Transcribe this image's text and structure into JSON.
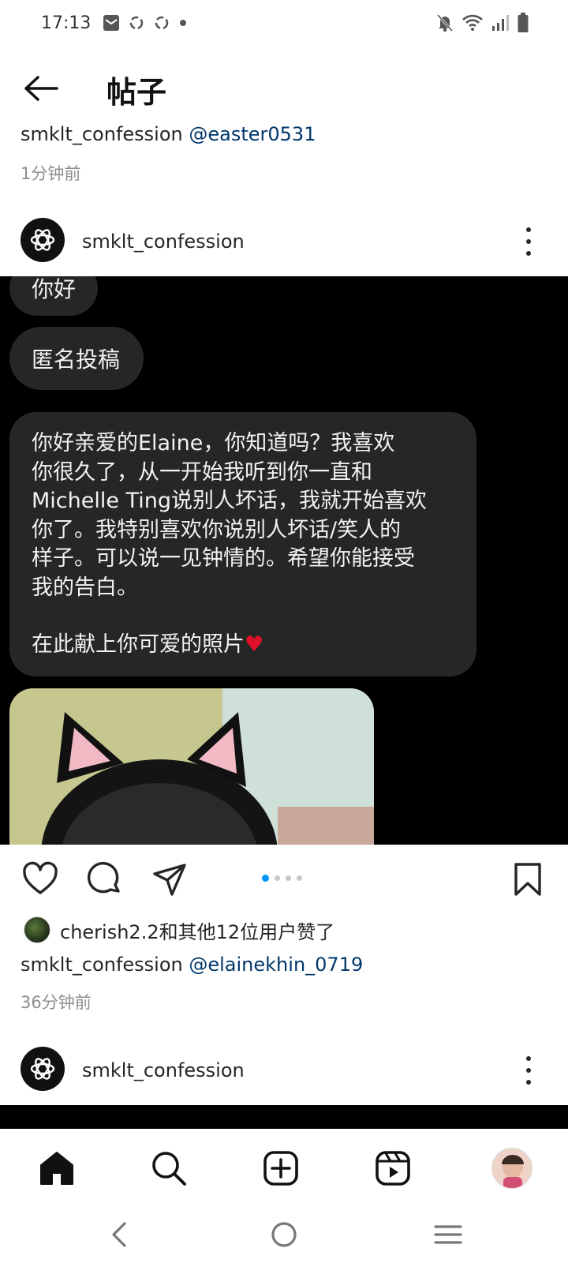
{
  "status_bar": {
    "time": "17:13",
    "left_icons": [
      "mail-icon",
      "recycle-icon",
      "recycle-icon",
      "dot-icon"
    ],
    "right_icons": [
      "bell-muted-icon",
      "wifi-icon",
      "signal-icon",
      "battery-icon"
    ]
  },
  "header": {
    "title": "帖子",
    "back_icon": "back-arrow-icon"
  },
  "prev_post": {
    "username": "smklt_confession",
    "mention": "@easter0531",
    "time_ago": "1分钟前"
  },
  "post": {
    "username": "smklt_confession",
    "avatar_icon": "openai-logo-icon",
    "image": {
      "bubble_1": "你好",
      "bubble_2": "匿名投稿",
      "message_lines": [
        "你好亲爱的Elaine，你知道吗？我喜欢",
        "你很久了，从一开始我听到你一直和",
        "Michelle Ting说别人坏话，我就开始喜欢",
        "你了。我特别喜欢你说别人坏话/笑人的",
        "样子。可以说一见钟情的。希望你能接受",
        "我的告白。"
      ],
      "message_end": "在此献上你可爱的照片",
      "heart_emoji": "❤️"
    },
    "carousel": {
      "total": 4,
      "active": 1
    },
    "likes_text": "cherish2.2和其他12位用户赞了",
    "caption_user": "smklt_confession",
    "caption_mention": "@elainekhin_0719",
    "time_ago": "36分钟前"
  },
  "next_post": {
    "username": "smklt_confession"
  },
  "bottom_nav": [
    "home-icon",
    "search-icon",
    "create-post-icon",
    "reels-icon",
    "profile-avatar"
  ],
  "system_nav": [
    "system-back-icon",
    "system-home-icon",
    "system-recents-icon"
  ],
  "colors": {
    "mention": "#00376b",
    "secondary_text": "#8e8e8e",
    "carousel_active": "#0095f6",
    "bubble_bg": "#262626"
  }
}
